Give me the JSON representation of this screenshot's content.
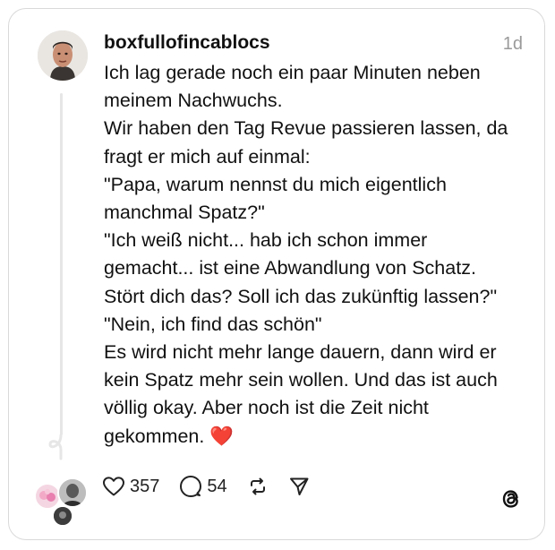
{
  "post": {
    "username": "boxfullofincablocs",
    "time": "1d",
    "lines": [
      "Ich lag gerade noch ein paar Minuten neben",
      "meinem Nachwuchs.",
      "Wir haben den Tag Revue passieren lassen, da",
      "fragt er mich auf einmal:",
      "\"Papa, warum nennst du mich eigentlich",
      "manchmal Spatz?\"",
      "\"Ich weiß nicht... hab ich schon immer",
      "gemacht... ist eine Abwandlung von Schatz.",
      "Stört dich das? Soll ich das zukünftig lassen?\"",
      "\"Nein, ich find das schön\"",
      "Es wird nicht mehr lange dauern, dann wird er",
      "kein Spatz mehr sein wollen. Und das ist auch",
      "völlig okay. Aber noch ist die Zeit nicht",
      "gekommen."
    ],
    "final_emoji": "❤️"
  },
  "actions": {
    "likes": "357",
    "replies": "54"
  },
  "icons": {
    "like": "heart-icon",
    "reply": "comment-icon",
    "repost": "repost-icon",
    "share": "send-icon",
    "brand": "threads-logo-icon"
  },
  "colors": {
    "heart": "#e0242b",
    "time": "#9a9a9a"
  }
}
